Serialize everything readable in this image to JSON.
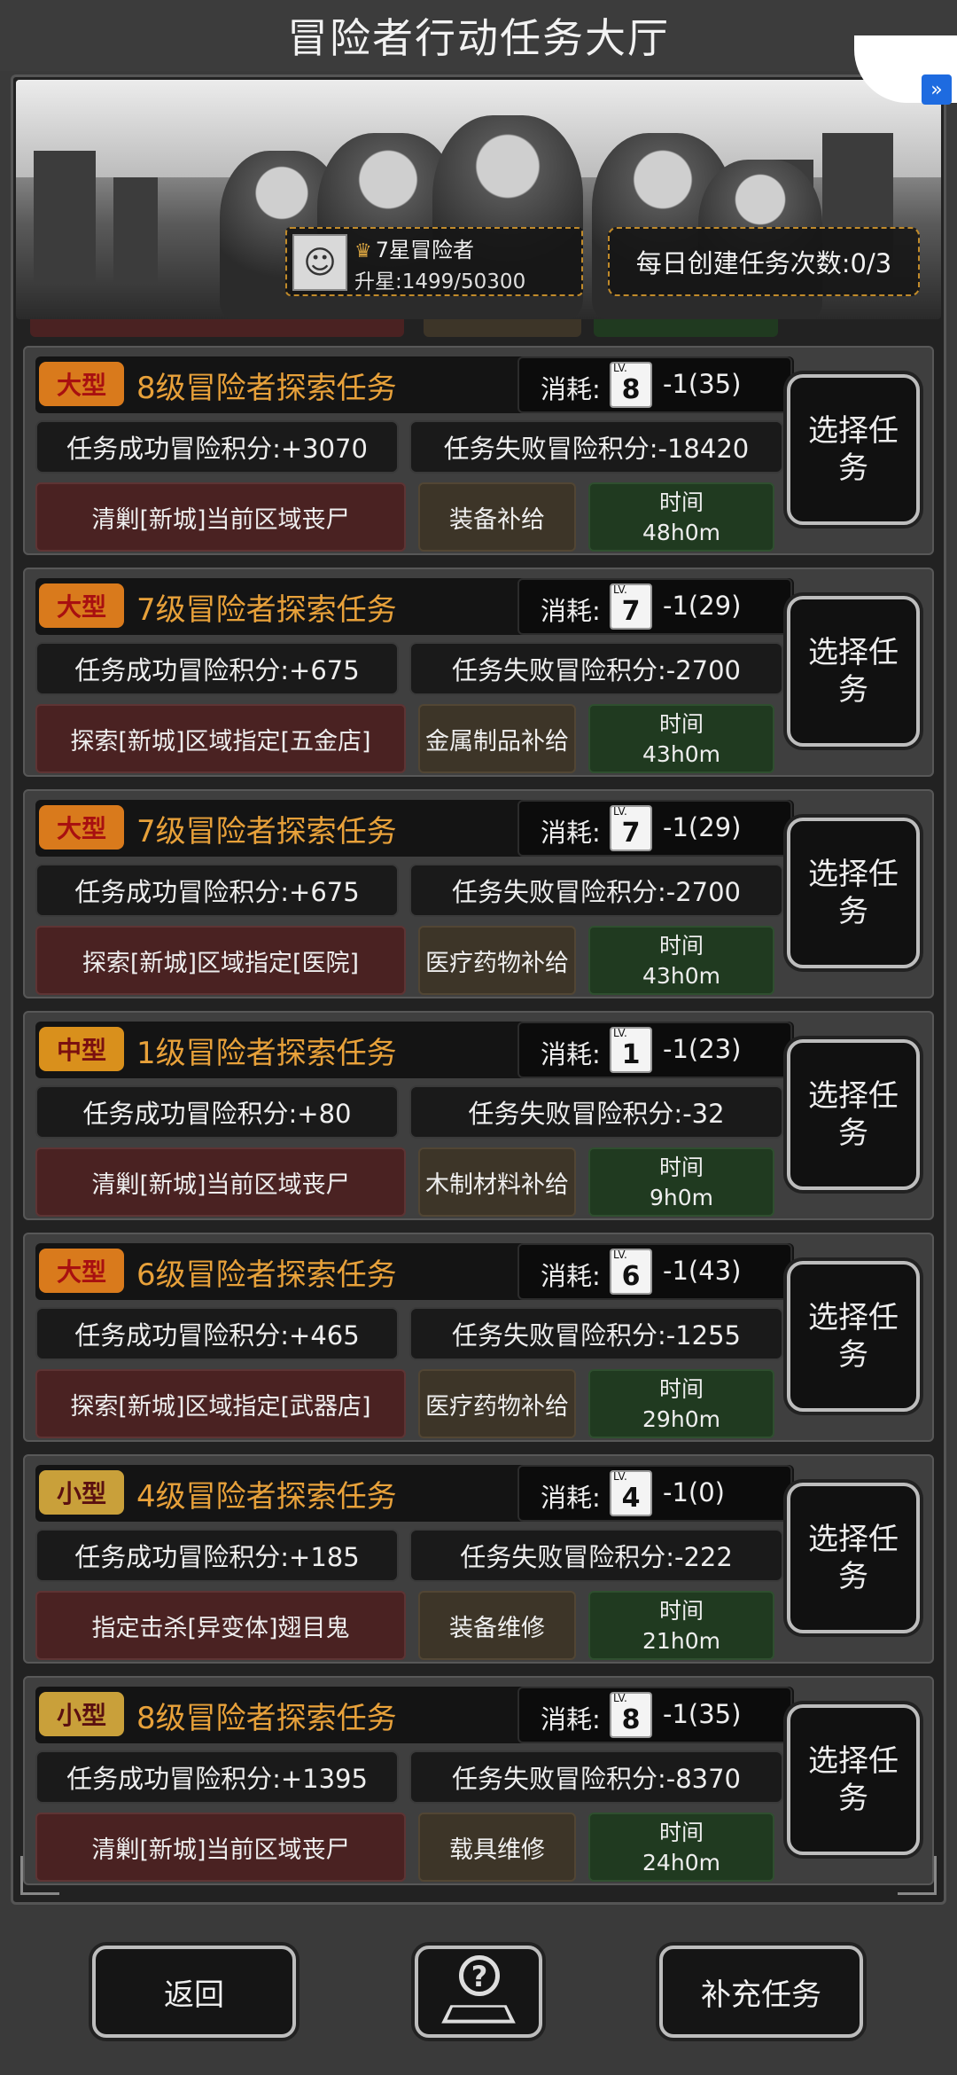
{
  "header": {
    "title": "冒险者行动任务大厅"
  },
  "rank": {
    "name": "7星冒险者",
    "progress": "升星:1499/50300"
  },
  "daily": {
    "label": "每日创建任务次数:0/3"
  },
  "cost_label": "消耗:",
  "lv_text": "LV.",
  "select_label": "选择任务",
  "time_label": "时间",
  "tasks": [
    {
      "size": "大型",
      "size_class": "big",
      "title": "8级冒险者探索任务",
      "lv": "8",
      "cost": "-1(35)",
      "success": "任务成功冒险积分:+3070",
      "fail": "任务失败冒险积分:-18420",
      "task": "清剿[新城]当前区域丧尸",
      "reward": "装备补给",
      "time": "48h0m"
    },
    {
      "size": "大型",
      "size_class": "big",
      "title": "7级冒险者探索任务",
      "lv": "7",
      "cost": "-1(29)",
      "success": "任务成功冒险积分:+675",
      "fail": "任务失败冒险积分:-2700",
      "task": "探索[新城]区域指定[五金店]",
      "reward": "金属制品补给",
      "time": "43h0m"
    },
    {
      "size": "大型",
      "size_class": "big",
      "title": "7级冒险者探索任务",
      "lv": "7",
      "cost": "-1(29)",
      "success": "任务成功冒险积分:+675",
      "fail": "任务失败冒险积分:-2700",
      "task": "探索[新城]区域指定[医院]",
      "reward": "医疗药物补给",
      "time": "43h0m"
    },
    {
      "size": "中型",
      "size_class": "mid",
      "title": "1级冒险者探索任务",
      "lv": "1",
      "cost": "-1(23)",
      "success": "任务成功冒险积分:+80",
      "fail": "任务失败冒险积分:-32",
      "task": "清剿[新城]当前区域丧尸",
      "reward": "木制材料补给",
      "time": "9h0m"
    },
    {
      "size": "大型",
      "size_class": "big",
      "title": "6级冒险者探索任务",
      "lv": "6",
      "cost": "-1(43)",
      "success": "任务成功冒险积分:+465",
      "fail": "任务失败冒险积分:-1255",
      "task": "探索[新城]区域指定[武器店]",
      "reward": "医疗药物补给",
      "time": "29h0m"
    },
    {
      "size": "小型",
      "size_class": "small",
      "title": "4级冒险者探索任务",
      "lv": "4",
      "cost": "-1(0)",
      "success": "任务成功冒险积分:+185",
      "fail": "任务失败冒险积分:-222",
      "task": "指定击杀[异变体]翅目鬼",
      "reward": "装备维修",
      "time": "21h0m"
    },
    {
      "size": "小型",
      "size_class": "small",
      "title": "8级冒险者探索任务",
      "lv": "8",
      "cost": "-1(35)",
      "success": "任务成功冒险积分:+1395",
      "fail": "任务失败冒险积分:-8370",
      "task": "清剿[新城]当前区域丧尸",
      "reward": "载具维修",
      "time": "24h0m"
    }
  ],
  "footer": {
    "back": "返回",
    "help_icon": "map-pin-question-icon",
    "supply": "补充任务"
  }
}
